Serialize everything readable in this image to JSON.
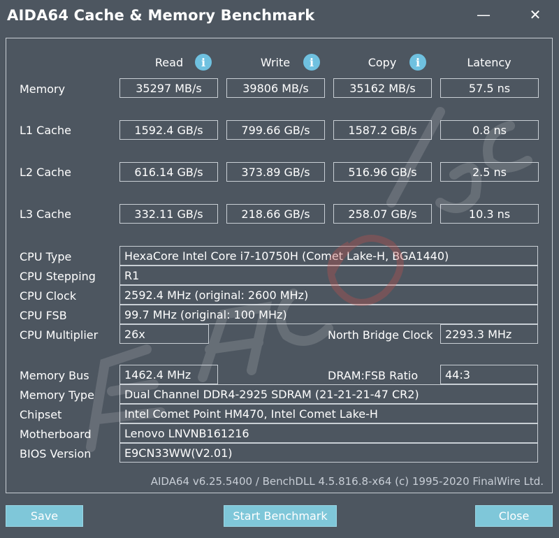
{
  "window": {
    "title": "AIDA64 Cache & Memory Benchmark",
    "minimize_glyph": "—",
    "close_glyph": "✕"
  },
  "columns": {
    "read": "Read",
    "write": "Write",
    "copy": "Copy",
    "latency": "Latency",
    "info_glyph": "i"
  },
  "rows": {
    "memory": {
      "label": "Memory",
      "read": "35297 MB/s",
      "write": "39806 MB/s",
      "copy": "35162 MB/s",
      "latency": "57.5 ns"
    },
    "l1": {
      "label": "L1 Cache",
      "read": "1592.4 GB/s",
      "write": "799.66 GB/s",
      "copy": "1587.2 GB/s",
      "latency": "0.8 ns"
    },
    "l2": {
      "label": "L2 Cache",
      "read": "616.14 GB/s",
      "write": "373.89 GB/s",
      "copy": "516.96 GB/s",
      "latency": "2.5 ns"
    },
    "l3": {
      "label": "L3 Cache",
      "read": "332.11 GB/s",
      "write": "218.66 GB/s",
      "copy": "258.07 GB/s",
      "latency": "10.3 ns"
    }
  },
  "cpu": {
    "type_label": "CPU Type",
    "type_value": "HexaCore Intel Core i7-10750H  (Comet Lake-H, BGA1440)",
    "stepping_label": "CPU Stepping",
    "stepping_value": "R1",
    "clock_label": "CPU Clock",
    "clock_value": "2592.4 MHz  (original: 2600 MHz)",
    "fsb_label": "CPU FSB",
    "fsb_value": "99.7 MHz  (original: 100 MHz)",
    "multiplier_label": "CPU Multiplier",
    "multiplier_value": "26x",
    "nb_clock_label": "North Bridge Clock",
    "nb_clock_value": "2293.3 MHz"
  },
  "system": {
    "bus_label": "Memory Bus",
    "bus_value": "1462.4 MHz",
    "ratio_label": "DRAM:FSB Ratio",
    "ratio_value": "44:3",
    "type_label": "Memory Type",
    "type_value": "Dual Channel DDR4-2925 SDRAM  (21-21-21-47 CR2)",
    "chipset_label": "Chipset",
    "chipset_value": "Intel Comet Point HM470, Intel Comet Lake-H",
    "motherboard_label": "Motherboard",
    "motherboard_value": "Lenovo LNVNB161216",
    "bios_label": "BIOS Version",
    "bios_value": "E9CN33WW(V2.01)"
  },
  "footer": {
    "text": "AIDA64 v6.25.5400 / BenchDLL 4.5.816.8-x64  (c) 1995-2020 FinalWire Ltd."
  },
  "buttons": {
    "save": "Save",
    "start": "Start Benchmark",
    "close": "Close"
  },
  "colors": {
    "background": "#4d5660",
    "button": "#7fc7d9",
    "info_icon": "#6fc1e0",
    "border": "#c9cfd5"
  }
}
